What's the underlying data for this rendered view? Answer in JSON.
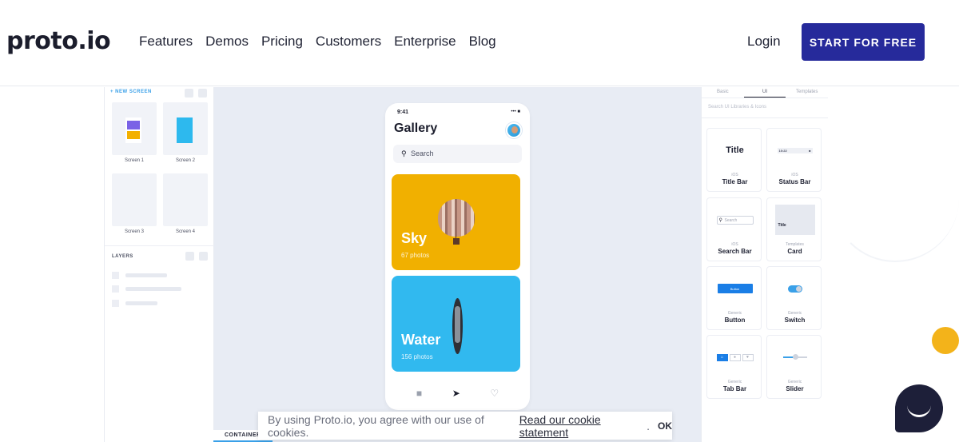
{
  "header": {
    "logo": "proto.io",
    "nav": [
      "Features",
      "Demos",
      "Pricing",
      "Customers",
      "Enterprise",
      "Blog"
    ],
    "login": "Login",
    "cta": "START FOR FREE"
  },
  "left_panel": {
    "new_screen": "+ NEW SCREEN",
    "screens": [
      "Screen 1",
      "Screen 2",
      "Screen 3",
      "Screen 4"
    ],
    "layers_title": "LAYERS"
  },
  "phone": {
    "time": "9:41",
    "status": "••• ■",
    "title": "Gallery",
    "search_placeholder": "Search",
    "cards": [
      {
        "title": "Sky",
        "subtitle": "67 photos",
        "color": "#f1b000"
      },
      {
        "title": "Water",
        "subtitle": "156 photos",
        "color": "#31b9ef"
      }
    ]
  },
  "right_panel": {
    "tabs": [
      "Basic",
      "UI",
      "Templates"
    ],
    "search_placeholder": "Search UI Libraries & Icons",
    "components": [
      {
        "category": "iOS",
        "name": "Title Bar",
        "preview_text": "Title"
      },
      {
        "category": "iOS",
        "name": "Status Bar",
        "preview_text": "10:22"
      },
      {
        "category": "iOS",
        "name": "Search Bar",
        "preview_text": "Search"
      },
      {
        "category": "Templates",
        "name": "Card",
        "preview_text": "Title"
      },
      {
        "category": "Generic",
        "name": "Button",
        "preview_text": "Button"
      },
      {
        "category": "Generic",
        "name": "Switch",
        "preview_text": ""
      },
      {
        "category": "Generic",
        "name": "Tab Bar",
        "preview_text": ""
      },
      {
        "category": "Generic",
        "name": "Slider",
        "preview_text": ""
      }
    ]
  },
  "bottom": {
    "container_tab": "CONTAINER",
    "cookie_text": "By using Proto.io, you agree with our use of cookies.",
    "cookie_link": "Read our cookie statement",
    "cookie_ok": "OK"
  },
  "colors": {
    "brand": "#262a9b",
    "accent": "#3aa0e8",
    "sky_card": "#f1b000",
    "water_card": "#31b9ef"
  }
}
